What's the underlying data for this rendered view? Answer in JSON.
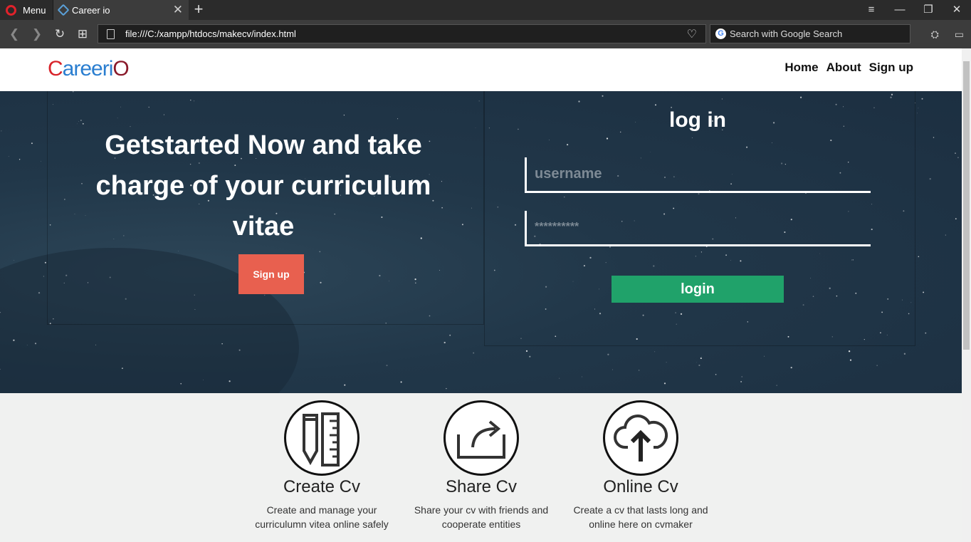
{
  "browser": {
    "menu_label": "Menu",
    "tab_title": "Career io",
    "url": "file:///C:/xampp/htdocs/makecv/index.html",
    "search_placeholder": "Search with Google Search"
  },
  "nav": {
    "logo": {
      "a": "C",
      "b": "areeri",
      "c": "O"
    },
    "links": [
      "Home",
      "About",
      "Sign up"
    ]
  },
  "hero": {
    "headline": "Getstarted Now and take charge of your curriculum vitae",
    "signup_label": "Sign up"
  },
  "login": {
    "title": "log in",
    "username_placeholder": "username",
    "password_placeholder": "**********",
    "button_label": "login"
  },
  "features": [
    {
      "title": "Create Cv",
      "desc": "Create and manage your curriculumn vitea online safely",
      "icon": "pencil-ruler-icon"
    },
    {
      "title": "Share Cv",
      "desc": "Share your cv with friends and cooperate entities",
      "icon": "share-icon"
    },
    {
      "title": "Online Cv",
      "desc": "Create a cv that lasts long and online here on cvmaker",
      "icon": "cloud-upload-icon"
    }
  ],
  "colors": {
    "accent_signup": "#e8604f",
    "accent_login": "#20a26a",
    "hero_bg": "#213749"
  }
}
